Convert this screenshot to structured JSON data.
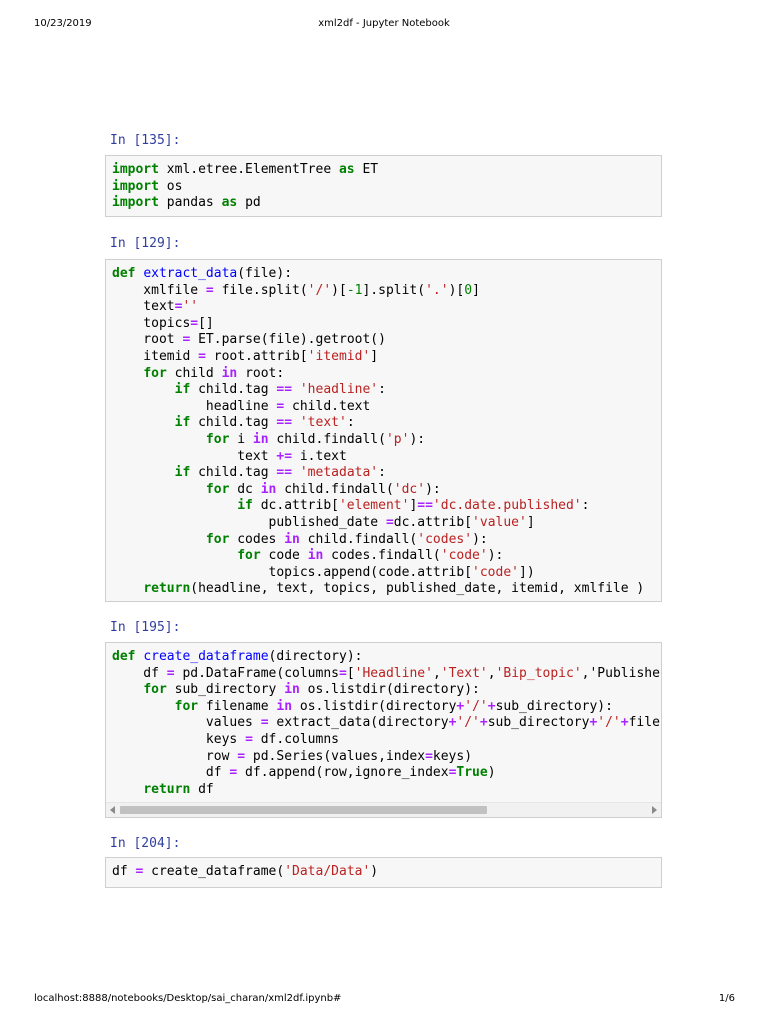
{
  "header": {
    "date": "10/23/2019",
    "title": "xml2df - Jupyter Notebook"
  },
  "footer": {
    "url": "localhost:8888/notebooks/Desktop/sai_charan/xml2df.ipynb#",
    "page": "1/6"
  },
  "cells": [
    {
      "prompt": "In [135]:",
      "lines": [
        "import xml.etree.ElementTree as ET",
        "import os",
        "import pandas as pd"
      ]
    },
    {
      "prompt": "In [129]:",
      "lines": [
        "def extract_data(file):",
        "    xmlfile = file.split('/')[-1].split('.')[0]",
        "    text=''",
        "    topics=[]",
        "    root = ET.parse(file).getroot()",
        "    itemid = root.attrib['itemid']",
        "    for child in root:",
        "        if child.tag == 'headline':",
        "            headline = child.text",
        "        if child.tag == 'text':",
        "            for i in child.findall('p'):",
        "                text += i.text",
        "        if child.tag == 'metadata':",
        "            for dc in child.findall('dc'):",
        "                if dc.attrib['element']=='dc.date.published':",
        "                    published_date =dc.attrib['value']",
        "            for codes in child.findall('codes'):",
        "                for code in codes.findall('code'):",
        "                    topics.append(code.attrib['code'])",
        "    return(headline, text, topics, published_date, itemid, xmlfile )"
      ]
    },
    {
      "prompt": "In [195]:",
      "lines": [
        "def create_dataframe(directory):",
        "    df = pd.DataFrame(columns=['Headline','Text','Bip_topic','Publishe",
        "    for sub_directory in os.listdir(directory):",
        "        for filename in os.listdir(directory+'/'+sub_directory):",
        "            values = extract_data(directory+'/'+sub_directory+'/'+file",
        "            keys = df.columns",
        "            row = pd.Series(values,index=keys)",
        "            df = df.append(row,ignore_index=True)",
        "    return df"
      ]
    },
    {
      "prompt": "In [204]:",
      "lines": [
        "df = create_dataframe('Data/Data')"
      ]
    }
  ]
}
